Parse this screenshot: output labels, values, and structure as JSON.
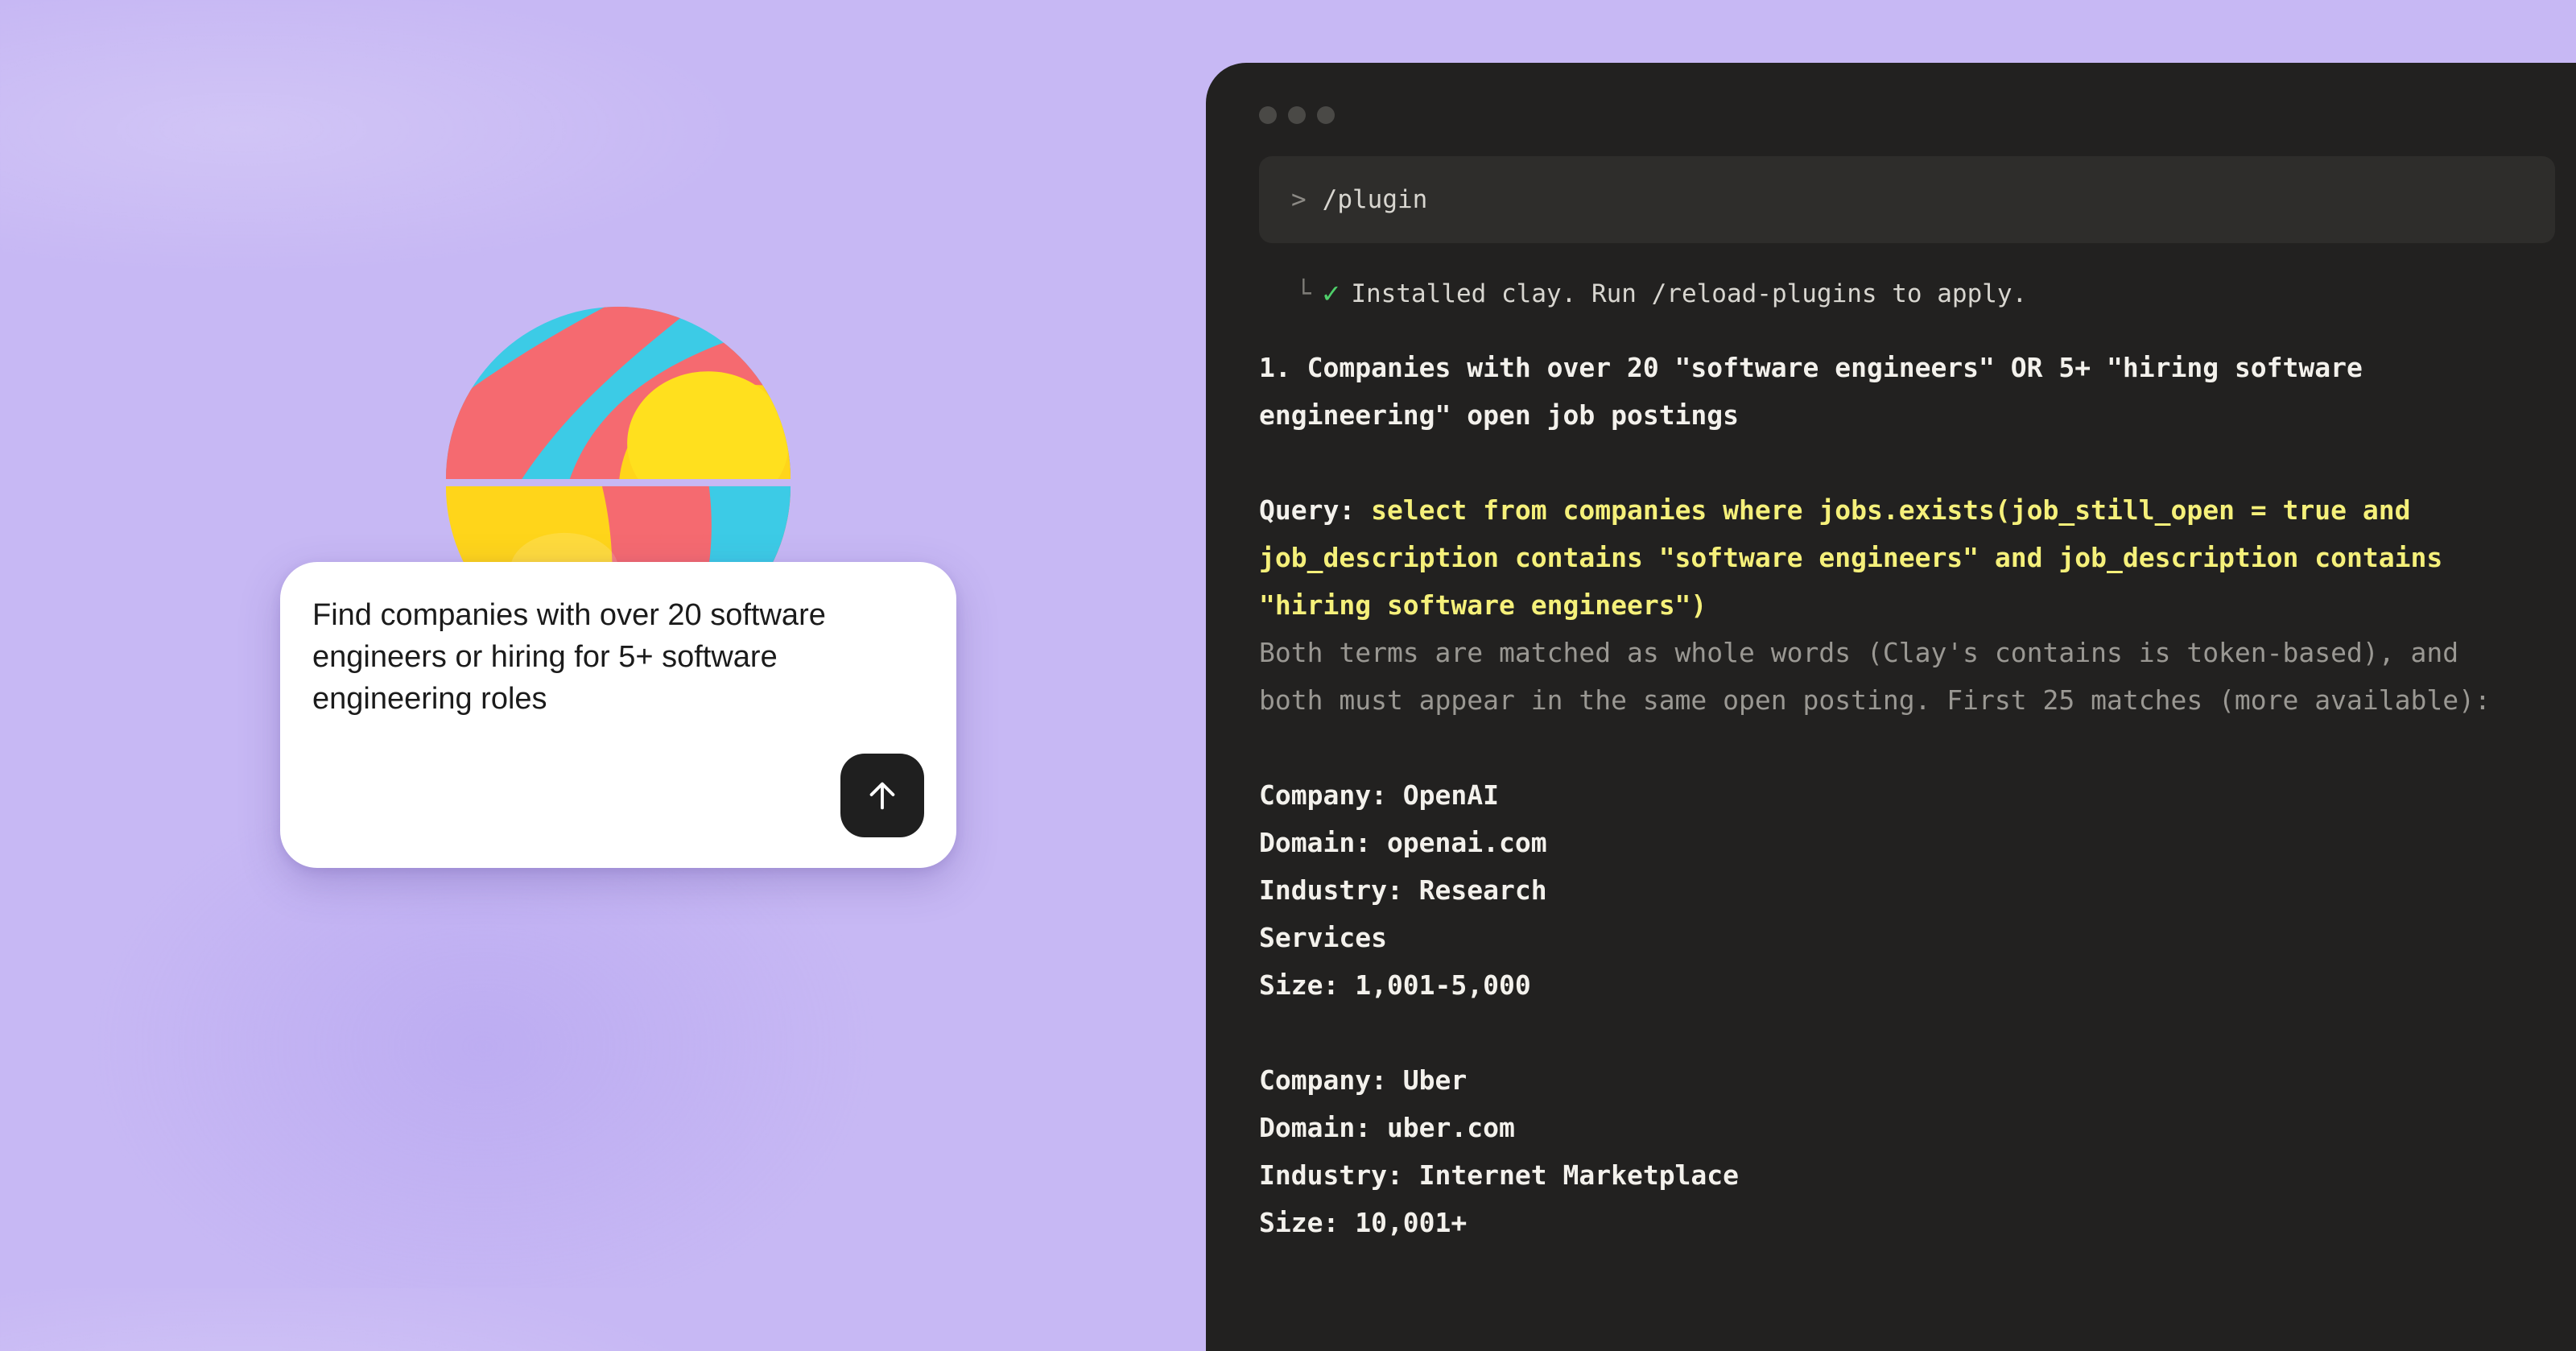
{
  "prompt": {
    "text": "Find companies with over 20 software engineers or hiring for 5+ software engineering roles",
    "send_icon": "arrow-up-icon"
  },
  "terminal": {
    "command": "/plugin",
    "command_prompt": ">",
    "install_tree": "└",
    "install_check": "✓",
    "install_message": "Installed clay. Run /reload-plugins to apply.",
    "heading_lines": [
      "1. Companies with over 20 \"software engineers\" OR 5+ \"hiring software",
      "engineering\" open job postings"
    ],
    "query_label": "Query: ",
    "query_lines": [
      "select from companies where jobs.exists(job_still_open = true and",
      "job_description contains \"software engineers\" and job_description contains",
      "\"hiring software engineers\")"
    ],
    "note_lines": [
      "Both terms are matched as whole words (Clay's contains is token-based), and",
      "both must appear in the same open posting. First 25 matches (more available):"
    ],
    "companies": [
      {
        "company": "Company: OpenAI",
        "domain": "Domain: openai.com",
        "industry": "Industry: Research",
        "industry_cont": "Services",
        "size": "Size: 1,001-5,000"
      },
      {
        "company": "Company: Uber",
        "domain": "Domain: uber.com",
        "industry": "Industry: Internet Marketplace",
        "size": "Size: 10,001+"
      }
    ]
  },
  "colors": {
    "background": "#c7b8f4",
    "terminal_bg": "#222120",
    "query_yellow": "#f5f07a",
    "check_green": "#4fcf6a"
  }
}
